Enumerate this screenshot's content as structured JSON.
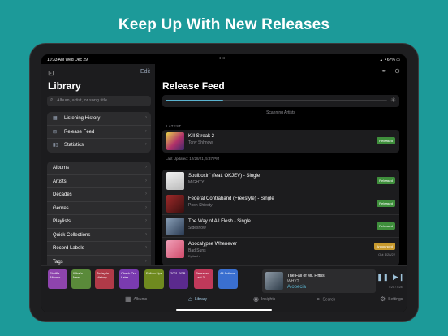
{
  "headline": "Keep Up With New Releases",
  "status": {
    "time": "10:33 AM  Wed Dec 29",
    "dots": "•••",
    "battery": "67%"
  },
  "sidebar": {
    "edit": "Edit",
    "title": "Library",
    "search_placeholder": "Album, artist, or song title...",
    "top_items": [
      {
        "label": "Listening History",
        "icon": "calendar-icon"
      },
      {
        "label": "Release Feed",
        "icon": "inbox-icon"
      },
      {
        "label": "Statistics",
        "icon": "bar-chart-icon"
      }
    ],
    "items": [
      {
        "label": "Albums"
      },
      {
        "label": "Artists"
      },
      {
        "label": "Decades"
      },
      {
        "label": "Genres"
      },
      {
        "label": "Playlists"
      },
      {
        "label": "Quick Collections"
      },
      {
        "label": "Record Labels"
      },
      {
        "label": "Tags"
      }
    ]
  },
  "main": {
    "title": "Release Feed",
    "progress": 0.26,
    "scan_status": "Scanning Artists",
    "latest_label": "LATEST",
    "latest": {
      "title": "Kill Streak 2",
      "artist": "Tony Shhnow",
      "badge": "Released"
    },
    "last_updated": "Last Updated: 12/28/21, 5:37 PM",
    "releases": [
      {
        "title": "Soulboxin' (feat. OKJEV) - Single",
        "artist": "MIGHTY",
        "extra": "",
        "badge": "Released",
        "badge_type": "released",
        "date": ""
      },
      {
        "title": "Federal Contraband (Freestyle) - Single",
        "artist": "Pooh Shiesty",
        "extra": "",
        "badge": "Released",
        "badge_type": "released",
        "date": ""
      },
      {
        "title": "The Way of All Flesh - Single",
        "artist": "Sideshow",
        "extra": "",
        "badge": "Released",
        "badge_type": "released",
        "date": ""
      },
      {
        "title": "Apocalypse Whenever",
        "artist": "Bad Suns",
        "extra": "Epitaph",
        "badge": "Announced",
        "badge_type": "announced",
        "date": "Out 1/28/22"
      }
    ]
  },
  "shortcuts": [
    {
      "label": "Shuffle Albums",
      "color": "#8e44ad"
    },
    {
      "label": "What's New",
      "color": "#5a8a3a"
    },
    {
      "label": "Today In History",
      "color": "#b03a48"
    },
    {
      "label": "Check Out Later",
      "color": "#7a3bb0"
    },
    {
      "label": "Follow Ups",
      "color": "#6f8a1f"
    },
    {
      "label": "2021 PGB",
      "color": "#5b2a8e"
    },
    {
      "label": "Released Last 3...",
      "color": "#c0395a"
    },
    {
      "label": "All Actions",
      "color": "#3a6fd0"
    }
  ],
  "player": {
    "song": "The Fall of Mr. Fifths",
    "artist": "WHY?",
    "album": "Alopecia",
    "time": "4:20 / 4:28"
  },
  "tabs": [
    {
      "label": "Albums",
      "icon": "grid-icon"
    },
    {
      "label": "Library",
      "icon": "home-icon"
    },
    {
      "label": "Insights",
      "icon": "lightbulb-icon"
    },
    {
      "label": "Search",
      "icon": "search-icon"
    },
    {
      "label": "Settings",
      "icon": "settings-icon"
    }
  ]
}
